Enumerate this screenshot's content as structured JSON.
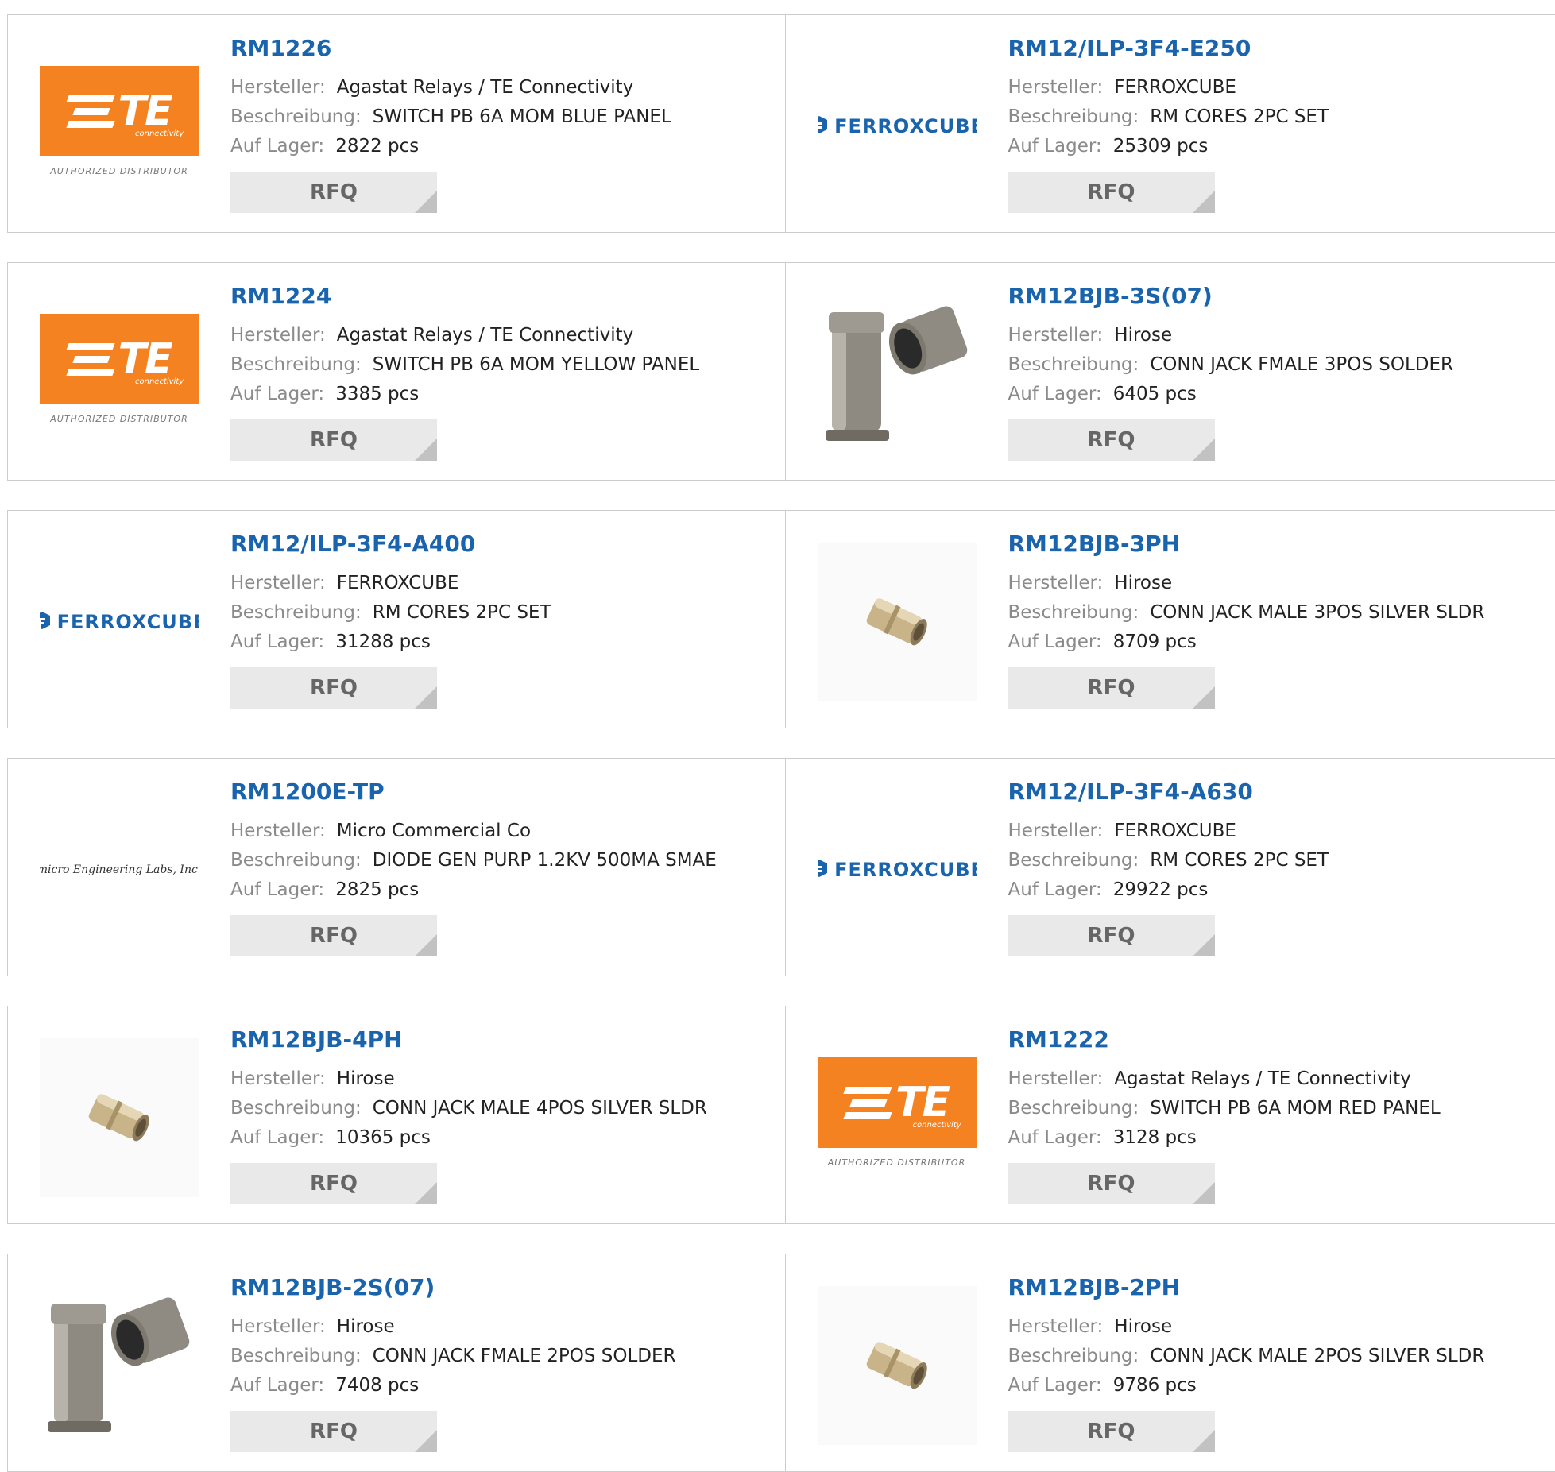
{
  "labels": {
    "manufacturer": "Hersteller:",
    "description": "Beschreibung:",
    "stock": "Auf Lager:",
    "rfq": "RFQ"
  },
  "logos": {
    "te_text": "TE",
    "te_sub": "connectivity",
    "te_authorized": "AUTHORIZED DISTRIBUTOR",
    "ferroxcube_text": "FERROXCUBE",
    "mel_text": "micro Engineering Labs, Inc."
  },
  "colors": {
    "link": "#1a64ad",
    "te_orange": "#f58220",
    "rfq_bg": "#e9e9e9"
  },
  "products": [
    {
      "pn": "RM1226",
      "manufacturer": "Agastat Relays / TE Connectivity",
      "description": "SWITCH PB 6A MOM BLUE PANEL",
      "stock": "2822 pcs",
      "image": "te-logo"
    },
    {
      "pn": "RM12/ILP-3F4-E250",
      "manufacturer": "FERROXCUBE",
      "description": "RM CORES 2PC SET",
      "stock": "25309 pcs",
      "image": "ferroxcube-logo"
    },
    {
      "pn": "RM1224",
      "manufacturer": "Agastat Relays / TE Connectivity",
      "description": "SWITCH PB 6A MOM YELLOW PANEL",
      "stock": "3385 pcs",
      "image": "te-logo"
    },
    {
      "pn": "RM12BJB-3S(07)",
      "manufacturer": "Hirose",
      "description": "CONN JACK FMALE 3POS SOLDER",
      "stock": "6405 pcs",
      "image": "connector-pair-photo"
    },
    {
      "pn": "RM12/ILP-3F4-A400",
      "manufacturer": "FERROXCUBE",
      "description": "RM CORES 2PC SET",
      "stock": "31288 pcs",
      "image": "ferroxcube-logo"
    },
    {
      "pn": "RM12BJB-3PH",
      "manufacturer": "Hirose",
      "description": "CONN JACK MALE 3POS SILVER SLDR",
      "stock": "8709 pcs",
      "image": "small-connector-photo"
    },
    {
      "pn": "RM1200E-TP",
      "manufacturer": "Micro Commercial Co",
      "description": "DIODE GEN PURP 1.2KV 500MA SMAE",
      "stock": "2825 pcs",
      "image": "mel-logo"
    },
    {
      "pn": "RM12/ILP-3F4-A630",
      "manufacturer": "FERROXCUBE",
      "description": "RM CORES 2PC SET",
      "stock": "29922 pcs",
      "image": "ferroxcube-logo"
    },
    {
      "pn": "RM12BJB-4PH",
      "manufacturer": "Hirose",
      "description": "CONN JACK MALE 4POS SILVER SLDR",
      "stock": "10365 pcs",
      "image": "small-connector-photo"
    },
    {
      "pn": "RM1222",
      "manufacturer": "Agastat Relays / TE Connectivity",
      "description": "SWITCH PB 6A MOM RED PANEL",
      "stock": "3128 pcs",
      "image": "te-logo"
    },
    {
      "pn": "RM12BJB-2S(07)",
      "manufacturer": "Hirose",
      "description": "CONN JACK FMALE 2POS SOLDER",
      "stock": "7408 pcs",
      "image": "connector-pair-photo"
    },
    {
      "pn": "RM12BJB-2PH",
      "manufacturer": "Hirose",
      "description": "CONN JACK MALE 2POS SILVER SLDR",
      "stock": "9786 pcs",
      "image": "small-connector-photo"
    }
  ]
}
